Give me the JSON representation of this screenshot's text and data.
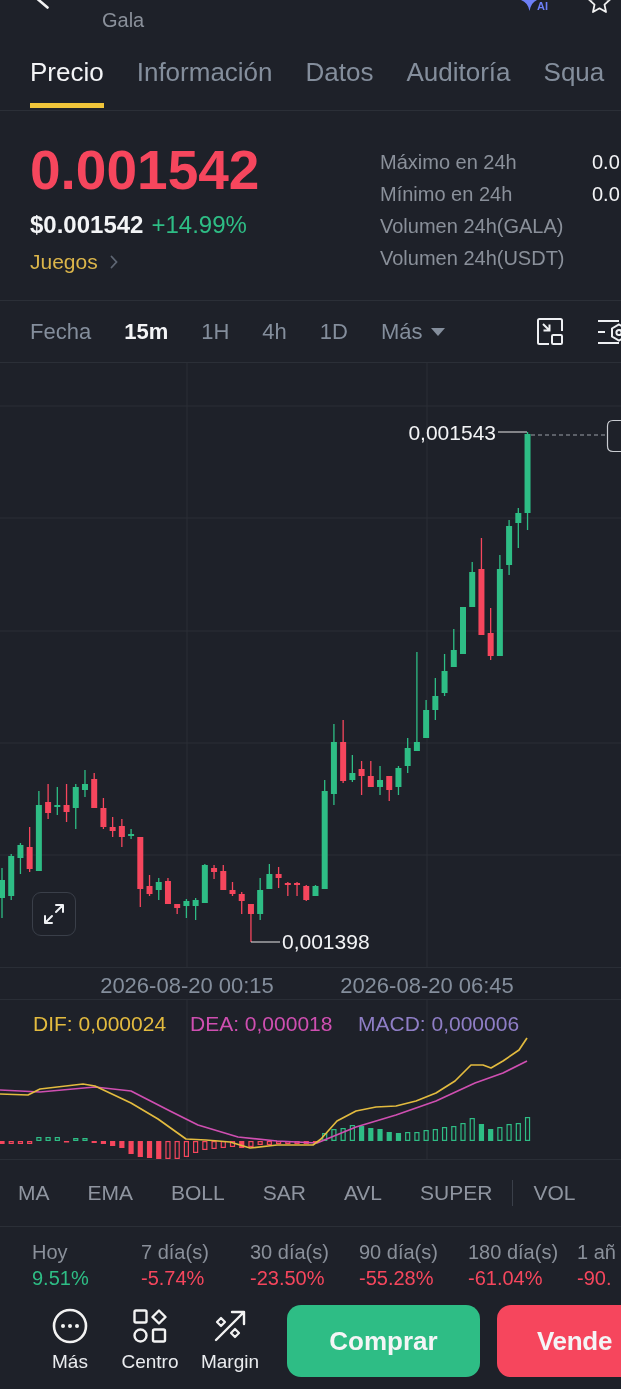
{
  "header": {
    "subtitle": "Gala",
    "ai_label": "AI",
    "favorite": false
  },
  "tabs": [
    {
      "label": "Precio",
      "selected": true
    },
    {
      "label": "Información",
      "selected": false
    },
    {
      "label": "Datos",
      "selected": false
    },
    {
      "label": "Auditoría",
      "selected": false
    },
    {
      "label": "Squa",
      "selected": false
    }
  ],
  "price": {
    "last": "0.001542",
    "last_up": false,
    "usd": "$0.001542",
    "change": "+14.99%",
    "change_up": true,
    "category": "Juegos"
  },
  "stats": [
    {
      "label": "Máximo en 24h",
      "value": "0.0"
    },
    {
      "label": "Mínimo en 24h",
      "value": "0.0"
    },
    {
      "label": "Volumen 24h(GALA)"
    },
    {
      "label": "Volumen 24h(USDT)"
    }
  ],
  "intervals": [
    {
      "label": "Fecha",
      "selected": false,
      "kind": "plain"
    },
    {
      "label": "15m",
      "selected": true,
      "kind": "plain"
    },
    {
      "label": "1H",
      "selected": false,
      "kind": "plain"
    },
    {
      "label": "4h",
      "selected": false,
      "kind": "plain"
    },
    {
      "label": "1D",
      "selected": false,
      "kind": "plain"
    },
    {
      "label": "Más",
      "selected": false,
      "kind": "dropdown"
    }
  ],
  "chart": {
    "high_label": "0,001543",
    "low_label": "0,001398",
    "time_labels": [
      "2026-08-20 00:15",
      "2026-08-20 06:45"
    ]
  },
  "macd": {
    "legend": [
      {
        "text": "DIF: 0,000024",
        "color": "#e3bb3f"
      },
      {
        "text": "DEA: 0,000018",
        "color": "#cf4fb1"
      },
      {
        "text": "MACD: 0,000006",
        "color": "#8f7ec6"
      }
    ]
  },
  "indicators": {
    "main": [
      "MA",
      "EMA",
      "BOLL",
      "SAR",
      "AVL",
      "SUPER"
    ],
    "sub": [
      "VOL"
    ]
  },
  "periods": [
    {
      "label": "Hoy",
      "value": "9.51%",
      "up": true
    },
    {
      "label": "7 día(s)",
      "value": "-5.74%",
      "up": false
    },
    {
      "label": "30 día(s)",
      "value": "-23.50%",
      "up": false
    },
    {
      "label": "90 día(s)",
      "value": "-55.28%",
      "up": false
    },
    {
      "label": "180 día(s)",
      "value": "-61.04%",
      "up": false
    },
    {
      "label": "1 añ",
      "value": "-90.",
      "up": false
    }
  ],
  "actions": [
    {
      "label": "Más"
    },
    {
      "label": "Centro"
    },
    {
      "label": "Margin"
    }
  ],
  "trade_buttons": [
    {
      "label": "Comprar",
      "kind": "buy"
    },
    {
      "label": "Vende",
      "kind": "sell"
    }
  ]
}
